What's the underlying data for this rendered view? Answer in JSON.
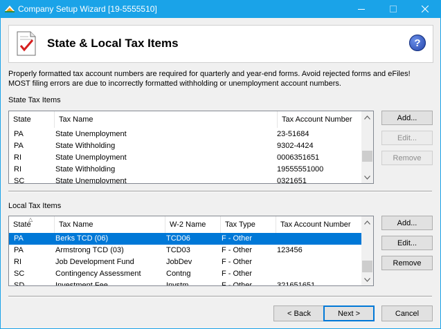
{
  "window": {
    "title": "Company Setup Wizard [19-5555510]",
    "accent": "#1aa3e8"
  },
  "header": {
    "title": "State & Local Tax Items",
    "help_glyph": "?"
  },
  "intro": "Properly formatted tax account numbers are required for quarterly and year-end forms. Avoid rejected forms and eFiles! MOST filing errors are due to incorrectly formatted withholding or unemployment account numbers.",
  "state_section": {
    "label": "State Tax Items",
    "columns": [
      "State",
      "Tax Name",
      "Tax Account Number"
    ],
    "rows": [
      {
        "state": "PA",
        "tax_name": "State Unemployment",
        "account": "23-51684"
      },
      {
        "state": "PA",
        "tax_name": "State Withholding",
        "account": "9302-4424"
      },
      {
        "state": "RI",
        "tax_name": "State Unemployment",
        "account": "0006351651"
      },
      {
        "state": "RI",
        "tax_name": "State Withholding",
        "account": "19555551000"
      },
      {
        "state": "SC",
        "tax_name": "State Unemployment",
        "account": "0321651"
      }
    ],
    "buttons": {
      "add": "Add...",
      "edit": "Edit...",
      "remove": "Remove"
    }
  },
  "local_section": {
    "label": "Local Tax Items",
    "columns": [
      "State",
      "Tax Name",
      "W-2 Name",
      "Tax Type",
      "Tax Account Number"
    ],
    "rows": [
      {
        "state": "PA",
        "tax_name": "Berks TCD (06)",
        "w2_name": "TCD06",
        "tax_type": "F - Other",
        "account": ""
      },
      {
        "state": "PA",
        "tax_name": "Armstrong TCD (03)",
        "w2_name": "TCD03",
        "tax_type": "F - Other",
        "account": "123456"
      },
      {
        "state": "RI",
        "tax_name": "Job Development Fund",
        "w2_name": "JobDev",
        "tax_type": "F - Other",
        "account": ""
      },
      {
        "state": "SC",
        "tax_name": "Contingency Assessment",
        "w2_name": "Contng",
        "tax_type": "F - Other",
        "account": ""
      },
      {
        "state": "SD",
        "tax_name": "Investment Fee",
        "w2_name": "Invstm",
        "tax_type": "F - Other",
        "account": "321651651"
      }
    ],
    "buttons": {
      "add": "Add...",
      "edit": "Edit...",
      "remove": "Remove"
    }
  },
  "nav": {
    "back": "< Back",
    "next": "Next >",
    "cancel": "Cancel"
  }
}
